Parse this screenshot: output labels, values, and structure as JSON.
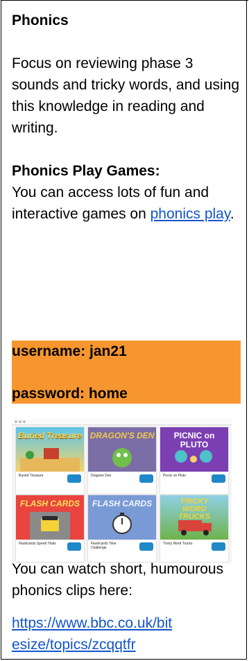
{
  "heading": "Phonics",
  "intro": "Focus on reviewing phase 3 sounds and tricky words, and using this knowledge in reading and writing.",
  "games_heading": "Phonics Play Games:",
  "games_text": "You can access lots of fun and interactive games on",
  "games_link": "phonics play",
  "games_end": ".",
  "username": "username: jan21",
  "password": "password: home",
  "highlight_color": "#f7962f",
  "link_color": "#1155cc",
  "thumbnail": {
    "cards": [
      {
        "title": "Buried Treasure",
        "caption": "Buried Treasure"
      },
      {
        "title": "DRAGON'S DEN",
        "caption": "Dragons Den"
      },
      {
        "title": "PICNIC on PLUTO",
        "caption": "Picnic on Pluto"
      },
      {
        "title": "FLASH CARDS",
        "caption": "Flashcards Speed Trials"
      },
      {
        "title": "FLASH CARDS",
        "caption": "Flashcards Time Challenge"
      },
      {
        "title": "TRICKY WORD TRUCKS",
        "caption": "Tricky Word Trucks"
      }
    ]
  },
  "clips_text": "You can watch short, humourous phonics clips here:",
  "clips_link_line1": "https://www.bbc.co.uk/bit",
  "clips_link_line2": "esize/topics/zcqqtfr"
}
